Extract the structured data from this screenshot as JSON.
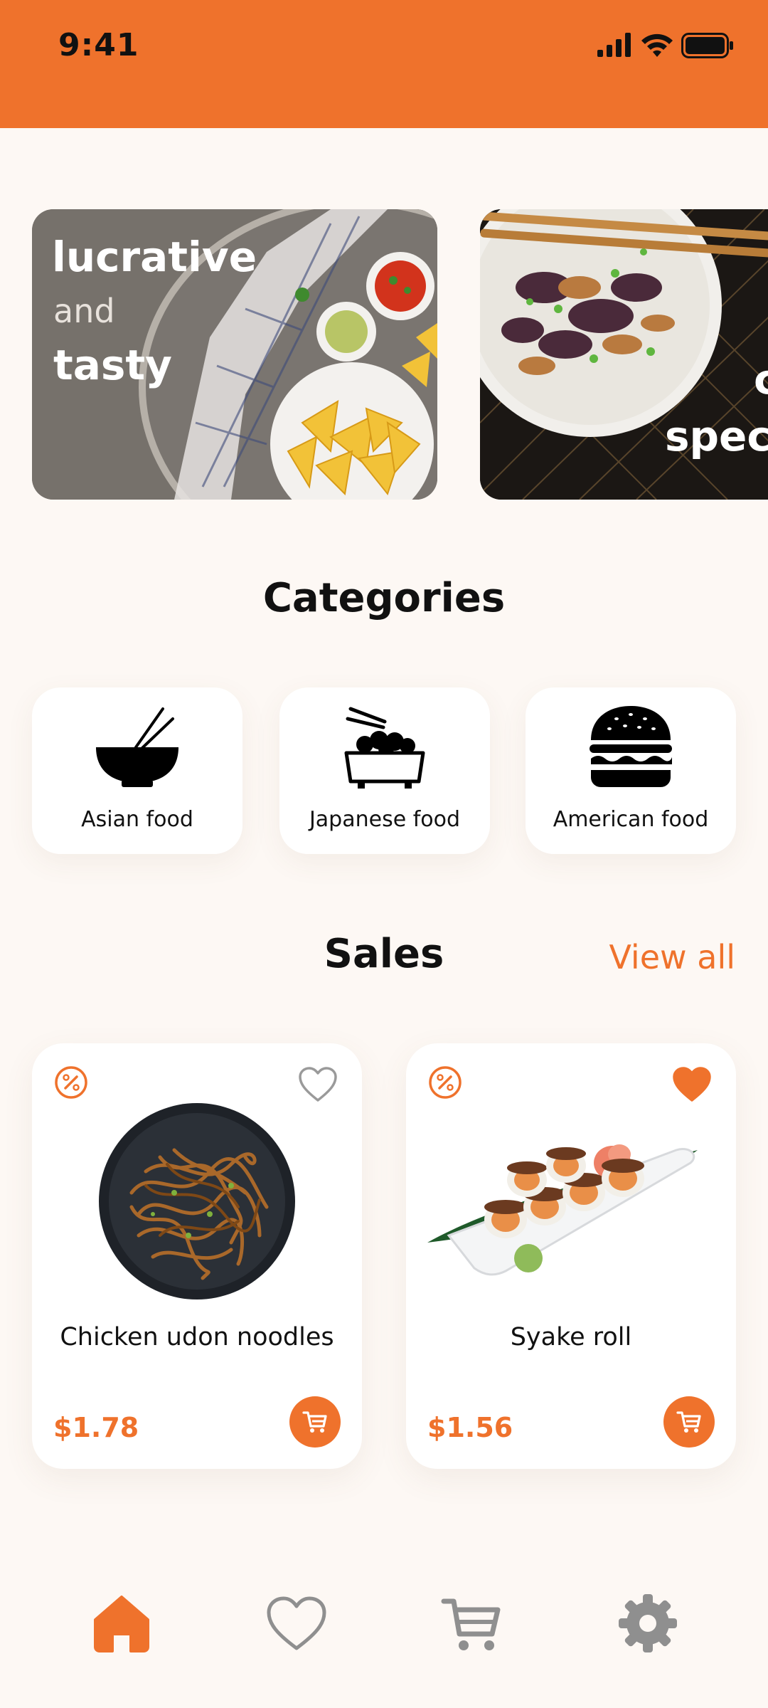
{
  "status_bar": {
    "time": "9:41",
    "icons": [
      "signal-icon",
      "wifi-icon",
      "battery-icon"
    ]
  },
  "promos": [
    {
      "line1": "lucrative",
      "line2": "and",
      "line3": "tasty"
    },
    {
      "line1": "c",
      "line2": "speci"
    }
  ],
  "categories": {
    "title": "Categories",
    "items": [
      {
        "label": "Asian food",
        "icon": "bowl-chopsticks-icon"
      },
      {
        "label": "Japanese food",
        "icon": "rice-bowl-icon"
      },
      {
        "label": "American food",
        "icon": "burger-icon"
      }
    ]
  },
  "sales": {
    "title": "Sales",
    "view_all": "View all",
    "products": [
      {
        "name": "Chicken udon noodles",
        "price": "$1.78",
        "favorite": false
      },
      {
        "name": "Syake roll",
        "price": "$1.56",
        "favorite": true
      }
    ]
  },
  "bottom_nav": {
    "items": [
      "home-icon",
      "heart-icon",
      "cart-icon",
      "gear-icon"
    ],
    "active": "home-icon"
  },
  "colors": {
    "accent": "#ef722c",
    "background": "#fdf8f4",
    "inactive_icon": "#8f8f8f"
  }
}
